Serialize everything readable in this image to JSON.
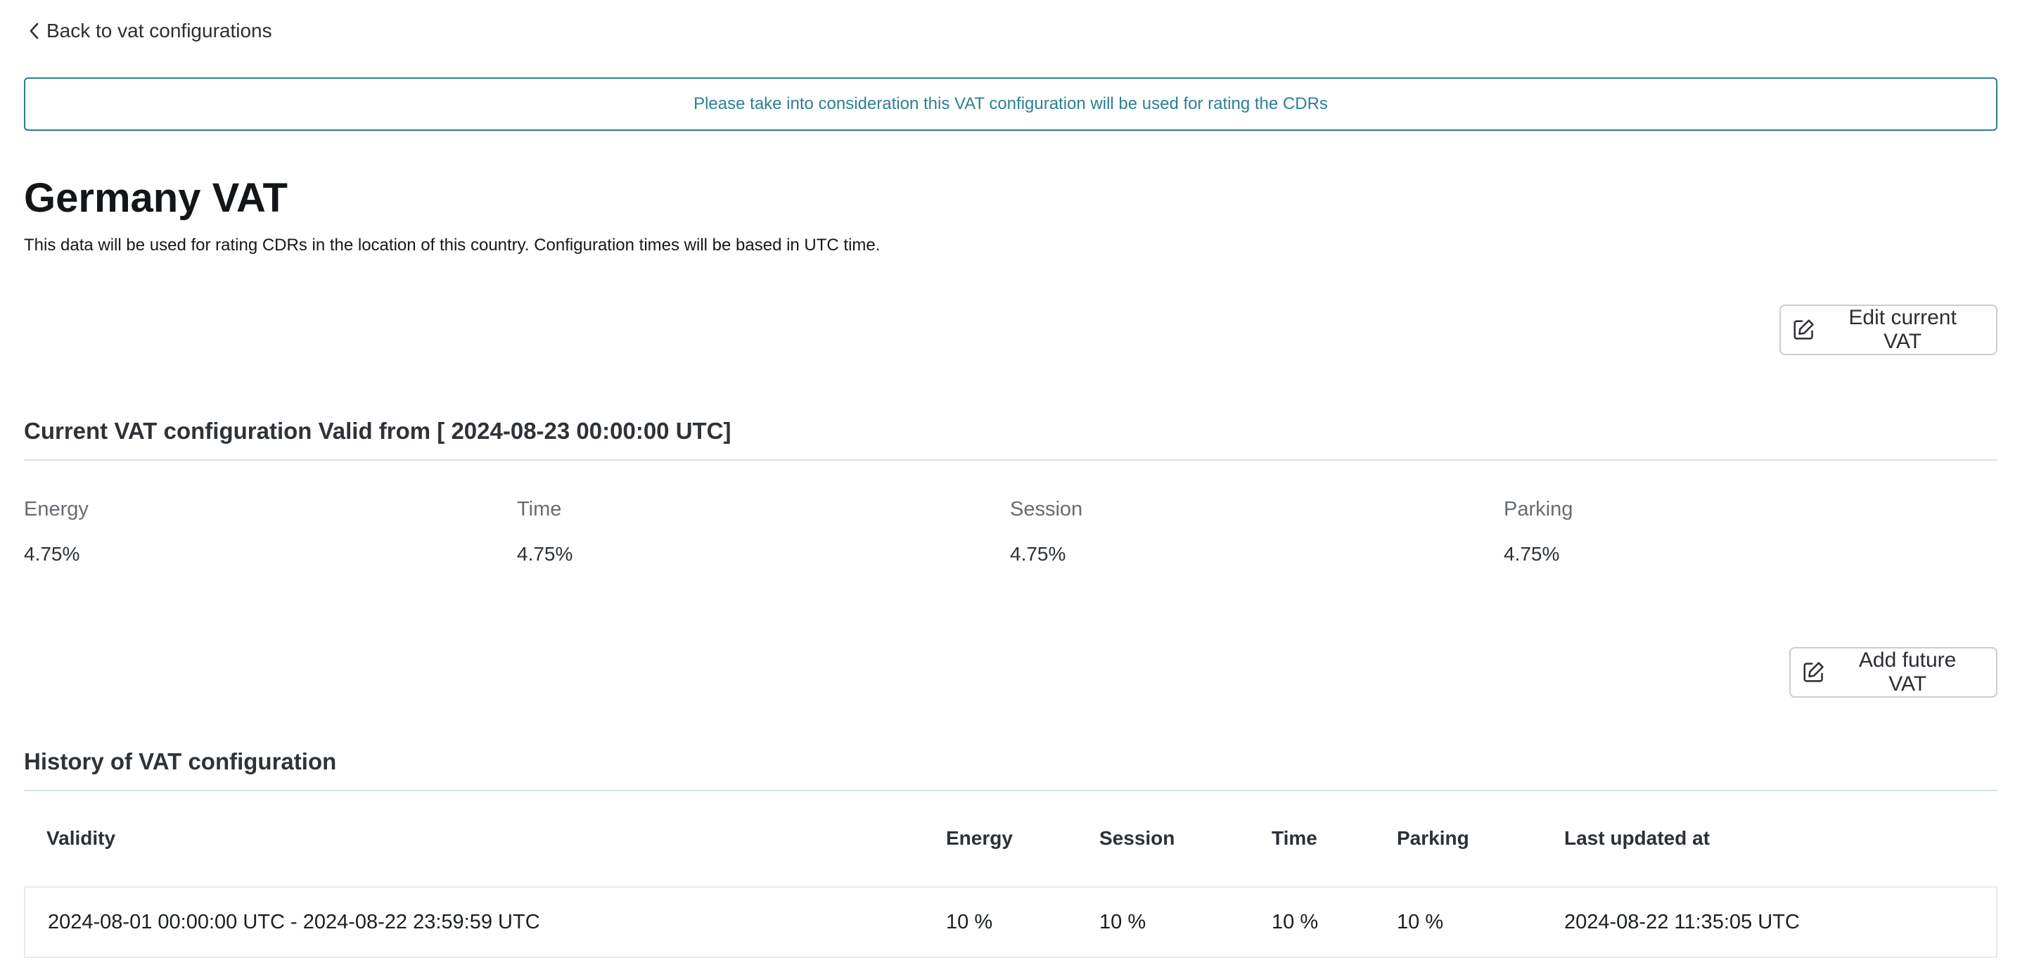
{
  "nav": {
    "back_label": "Back to vat configurations"
  },
  "notice": {
    "text": "Please take into consideration this VAT configuration will be used for rating the CDRs"
  },
  "header": {
    "title": "Germany VAT",
    "description": "This data will be used for rating CDRs in the location of this country. Configuration times will be based in UTC time."
  },
  "actions": {
    "edit_label": "Edit current VAT",
    "add_label": "Add future VAT"
  },
  "current": {
    "title": "Current VAT configuration Valid from [ 2024-08-23 00:00:00 UTC]",
    "fields": [
      {
        "label": "Energy",
        "value": "4.75%"
      },
      {
        "label": "Time",
        "value": "4.75%"
      },
      {
        "label": "Session",
        "value": "4.75%"
      },
      {
        "label": "Parking",
        "value": "4.75%"
      }
    ]
  },
  "history": {
    "title": "History of VAT configuration",
    "columns": [
      "Validity",
      "Energy",
      "Session",
      "Time",
      "Parking",
      "Last updated at"
    ],
    "rows": [
      [
        "2024-08-01 00:00:00 UTC - 2024-08-22 23:59:59 UTC",
        "10 %",
        "10 %",
        "10 %",
        "10 %",
        "2024-08-22 11:35:05 UTC"
      ]
    ]
  },
  "colors": {
    "accent": "#2c7f8c",
    "text": "#1f2326",
    "muted": "#666c72",
    "divider": "#d7e4e6"
  }
}
